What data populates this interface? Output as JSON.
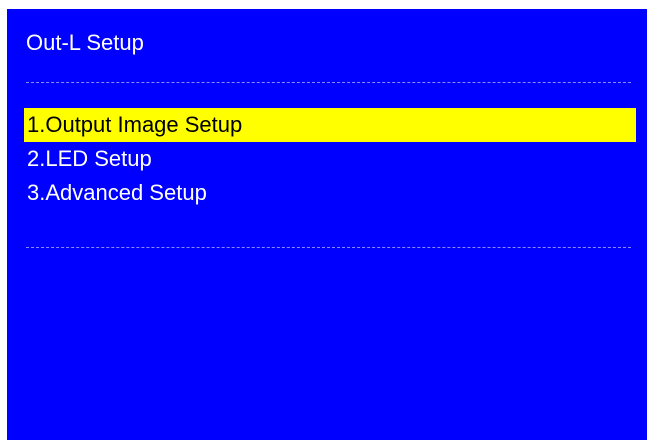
{
  "screen": {
    "title": "Out-L Setup"
  },
  "menu": {
    "items": [
      {
        "label": "1.Output Image Setup",
        "selected": true
      },
      {
        "label": "2.LED Setup",
        "selected": false
      },
      {
        "label": "3.Advanced Setup",
        "selected": false
      }
    ]
  },
  "colors": {
    "background": "#0000ff",
    "text": "#ffffff",
    "highlight": "#ffff00",
    "highlight_text": "#000000"
  }
}
